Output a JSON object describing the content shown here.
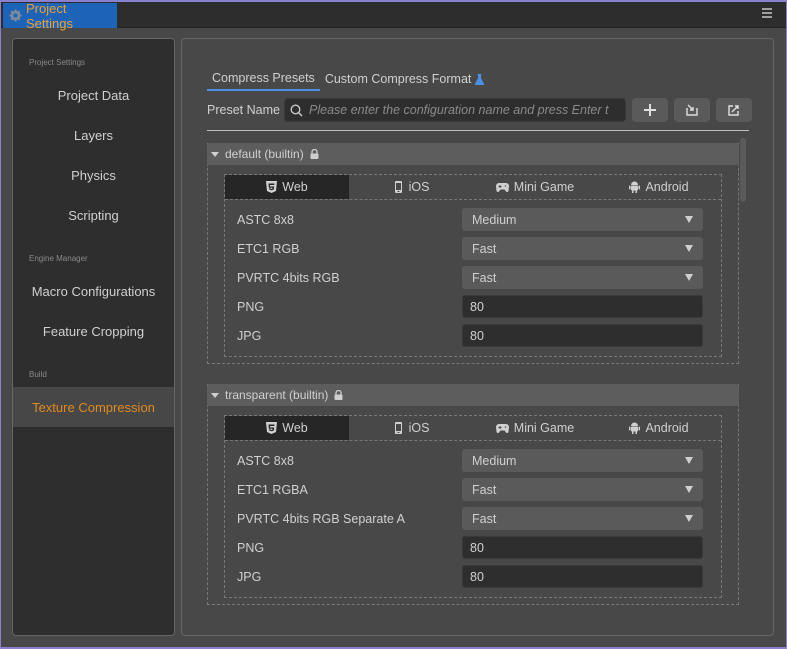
{
  "window": {
    "title": "Project Settings",
    "icons": {
      "title": "gear-icon",
      "menu": "hamburger-menu-icon"
    }
  },
  "sidebar": {
    "groups": [
      {
        "label": "Project Settings",
        "items": [
          "Project Data",
          "Layers",
          "Physics",
          "Scripting"
        ]
      },
      {
        "label": "Engine Manager",
        "items": [
          "Macro Configurations",
          "Feature Cropping"
        ]
      },
      {
        "label": "Build",
        "items": [
          "Texture Compression"
        ]
      }
    ],
    "active_item": "Texture Compression",
    "active_color": "#e08a20"
  },
  "main": {
    "tabs": [
      {
        "label": "Compress Presets",
        "active": true
      },
      {
        "label": "Custom Compress Format",
        "icon": "flask-icon",
        "active": false
      }
    ],
    "preset_name_label": "Preset Name",
    "search": {
      "value": "",
      "placeholder": "Please enter the configuration name and press Enter to a"
    },
    "buttons": [
      {
        "name": "add",
        "icon": "plus-icon"
      },
      {
        "name": "import",
        "icon": "import-icon"
      },
      {
        "name": "export",
        "icon": "export-icon"
      }
    ],
    "accent_color": "#4a90e2",
    "presets": [
      {
        "title": "default (builtin)",
        "locked": true,
        "platforms": [
          {
            "label": "Web",
            "icon": "html5-icon",
            "active": true
          },
          {
            "label": "iOS",
            "icon": "phone-icon",
            "active": false
          },
          {
            "label": "Mini Game",
            "icon": "gamepad-icon",
            "active": false
          },
          {
            "label": "Android",
            "icon": "android-icon",
            "active": false
          }
        ],
        "rows": [
          {
            "label": "ASTC 8x8",
            "type": "select",
            "value": "Medium"
          },
          {
            "label": "ETC1 RGB",
            "type": "select",
            "value": "Fast"
          },
          {
            "label": "PVRTC 4bits RGB",
            "type": "select",
            "value": "Fast"
          },
          {
            "label": "PNG",
            "type": "number",
            "value": "80"
          },
          {
            "label": "JPG",
            "type": "number",
            "value": "80"
          }
        ]
      },
      {
        "title": "transparent (builtin)",
        "locked": true,
        "platforms": [
          {
            "label": "Web",
            "icon": "html5-icon",
            "active": true
          },
          {
            "label": "iOS",
            "icon": "phone-icon",
            "active": false
          },
          {
            "label": "Mini Game",
            "icon": "gamepad-icon",
            "active": false
          },
          {
            "label": "Android",
            "icon": "android-icon",
            "active": false
          }
        ],
        "rows": [
          {
            "label": "ASTC 8x8",
            "type": "select",
            "value": "Medium"
          },
          {
            "label": "ETC1 RGBA",
            "type": "select",
            "value": "Fast"
          },
          {
            "label": "PVRTC 4bits RGB Separate A",
            "type": "select",
            "value": "Fast"
          },
          {
            "label": "PNG",
            "type": "number",
            "value": "80"
          },
          {
            "label": "JPG",
            "type": "number",
            "value": "80"
          }
        ]
      }
    ]
  }
}
